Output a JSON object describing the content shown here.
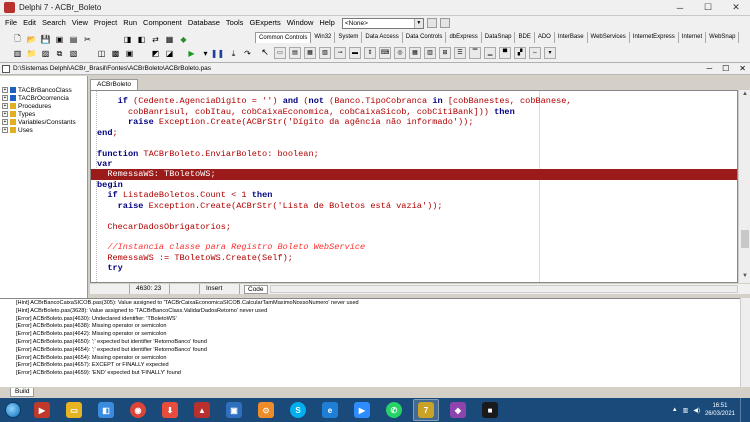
{
  "window": {
    "title": "Delphi 7 - ACBr_Boleto"
  },
  "menu": [
    "File",
    "Edit",
    "Search",
    "View",
    "Project",
    "Run",
    "Component",
    "Database",
    "Tools",
    "GExperts",
    "Window",
    "Help"
  ],
  "desktop_combo": "<None>",
  "palette_tabs": [
    "Common Controls",
    "Win32",
    "System",
    "Data Access",
    "Data Controls",
    "dbExpress",
    "DataSnap",
    "BDE",
    "ADO",
    "InterBase",
    "WebServices",
    "InternetExpress",
    "Internet",
    "WebSnap"
  ],
  "file_path": "D:\\Sistemas Delphi\\ACBr_Brasil\\Fontes\\ACBrBoleto\\ACBrBoleto.pas",
  "explorer": [
    "TACBrBancoClass",
    "TACBrOcorrencia",
    "Procedures",
    "Types",
    "Variables/Constants",
    "Uses"
  ],
  "editor_tab": "ACBrBoleto",
  "status": {
    "position": "4630: 23",
    "mode": "Insert",
    "view_tab": "Code"
  },
  "messages": [
    "[Hint] ACBrBancoCaixaSICOB.pas(305): Value assigned to 'TACBrCaixaEconomicaSICOB.CalcularTamMaximoNossoNumero' never used",
    "[Hint] ACBrBoleto.pas(3628): Value assigned to 'TACBrBancoClass.ValidarDadosRetorno' never used",
    "[Error] ACBrBoleto.pas(4630): Undeclared identifier: 'TBoletoWS'",
    "[Error] ACBrBoleto.pas(4638): Missing operator or semicolon",
    "[Error] ACBrBoleto.pas(4642): Missing operator or semicolon",
    "[Error] ACBrBoleto.pas(4650): ';' expected but identifier 'RetornoBanco' found",
    "[Error] ACBrBoleto.pas(4654): ';' expected but identifier 'RetornoBanco' found",
    "[Error] ACBrBoleto.pas(4654): Missing operator or semicolon",
    "[Error] ACBrBoleto.pas(4657): EXCEPT or FINALLY expected",
    "[Error] ACBrBoleto.pas(4659): 'END' expected but 'FINALLY' found"
  ],
  "messages_tab": "Build",
  "taskbar": {
    "time": "16:51",
    "date": "26/03/2021"
  }
}
